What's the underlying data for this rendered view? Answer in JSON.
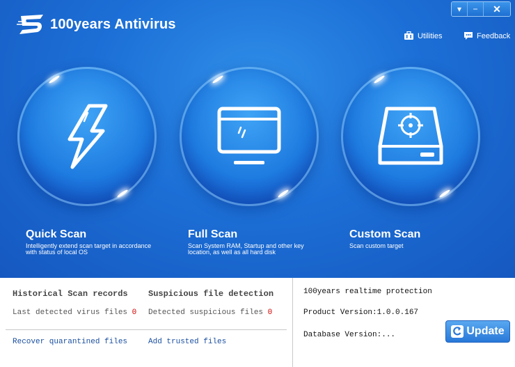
{
  "app": {
    "title": "100years Antivirus"
  },
  "window_controls": {
    "menu": "▾",
    "minimize": "−",
    "close": "✕"
  },
  "header_links": {
    "utilities": "Utilities",
    "feedback": "Feedback"
  },
  "scans": [
    {
      "title": "Quick Scan",
      "description": "Intelligently extend scan target in accordance with status of local OS",
      "icon": "lightning-icon"
    },
    {
      "title": "Full Scan",
      "description": "Scan System RAM, Startup and other key location, as well as all hard disk",
      "icon": "monitor-icon"
    },
    {
      "title": "Custom Scan",
      "description": "Scan custom target",
      "icon": "drive-target-icon"
    }
  ],
  "history": {
    "heading": "Historical Scan records",
    "last_detected_label": "Last detected virus files",
    "last_detected_count": "0",
    "recover_link": "Recover quarantined files"
  },
  "suspicious": {
    "heading": "Suspicious file detection",
    "detected_label": "Detected suspicious files",
    "detected_count": "0",
    "trusted_link": "Add trusted files"
  },
  "info": {
    "realtime": "100years realtime protection",
    "product_version": "Product Version:1.0.0.167",
    "database_version": "Database Version:..."
  },
  "update_button": "Update",
  "colors": {
    "top_bg": "#1c6fd6",
    "count_red": "#d00000",
    "link_blue": "#1a4fa0"
  }
}
